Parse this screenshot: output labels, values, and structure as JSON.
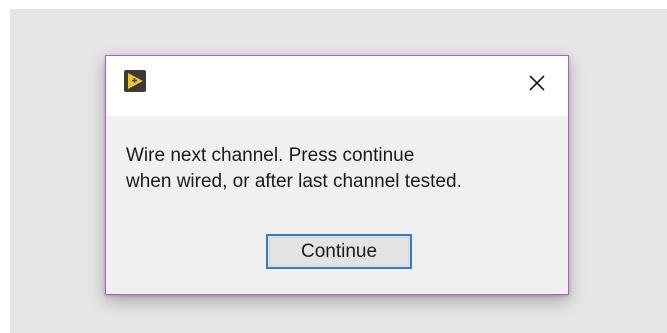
{
  "dialog": {
    "app_icon": "labview-run-arrow-icon",
    "close_icon": "close-x-icon",
    "message_line_1": "Wire next channel. Press continue",
    "message_line_2": "when wired, or after last channel tested.",
    "continue_label": "Continue"
  },
  "colors": {
    "backdrop": "#e6e6e6",
    "dialog_border": "#b35ec2",
    "dialog_body": "#f0f0f0",
    "titlebar": "#ffffff",
    "button_focus_border": "#2d7fd0",
    "icon_yellow": "#f5c518",
    "icon_dark": "#3a3a3a"
  }
}
